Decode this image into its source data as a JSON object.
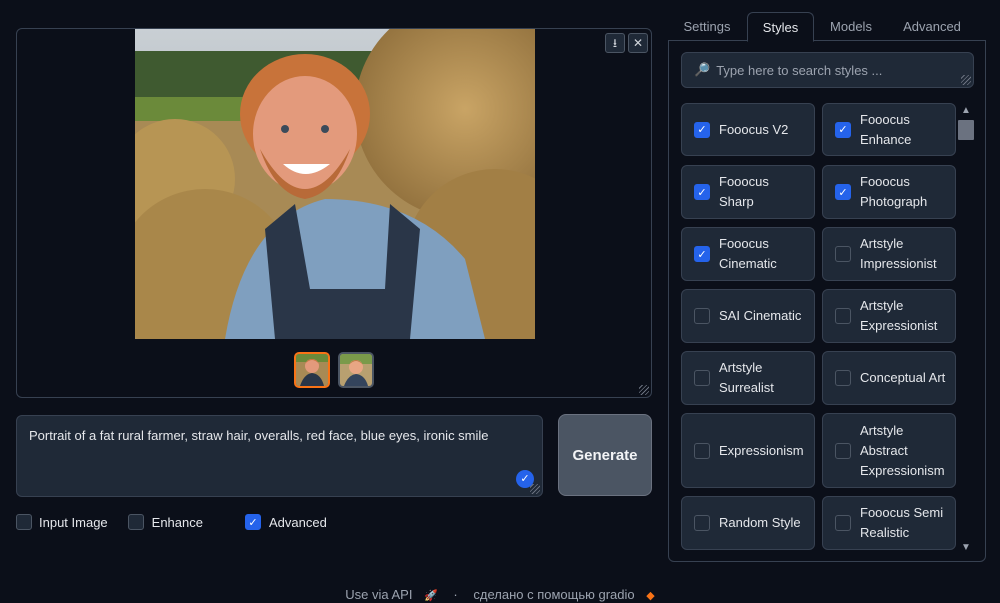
{
  "gallery": {
    "download_icon": "download-icon",
    "close_icon": "close-icon",
    "thumbnails": [
      "thumbnail-1",
      "thumbnail-2"
    ]
  },
  "prompt": {
    "value": "Portrait of a fat rural farmer, straw hair, overalls, red face, blue eyes, ironic smile"
  },
  "generate_label": "Generate",
  "options": [
    {
      "label": "Input Image",
      "checked": false
    },
    {
      "label": "Enhance",
      "checked": false
    },
    {
      "label": "Advanced",
      "checked": true
    }
  ],
  "tabs": [
    {
      "label": "Settings",
      "active": false
    },
    {
      "label": "Styles",
      "active": true
    },
    {
      "label": "Models",
      "active": false
    },
    {
      "label": "Advanced",
      "active": false
    }
  ],
  "search": {
    "placeholder": "Type here to search styles ..."
  },
  "styles": [
    {
      "label": "Fooocus V2",
      "checked": true
    },
    {
      "label": "Fooocus Enhance",
      "checked": true
    },
    {
      "label": "Fooocus Sharp",
      "checked": true
    },
    {
      "label": "Fooocus Photograph",
      "checked": true
    },
    {
      "label": "Fooocus Cinematic",
      "checked": true
    },
    {
      "label": "Artstyle Impressionist",
      "checked": false
    },
    {
      "label": "SAI Cinematic",
      "checked": false
    },
    {
      "label": "Artstyle Expressionist",
      "checked": false
    },
    {
      "label": "Artstyle Surrealist",
      "checked": false
    },
    {
      "label": "Conceptual Art",
      "checked": false
    },
    {
      "label": "Expressionism",
      "checked": false
    },
    {
      "label": "Artstyle Abstract Expressionism",
      "checked": false
    },
    {
      "label": "Random Style",
      "checked": false
    },
    {
      "label": "Fooocus Semi Realistic",
      "checked": false
    }
  ],
  "footer": {
    "api_label": "Use via API",
    "separator": "·",
    "built_with": "сделано с помощью gradio"
  },
  "colors": {
    "accent": "#2563eb",
    "active_thumb": "#f97316",
    "background": "#0b0f19"
  }
}
